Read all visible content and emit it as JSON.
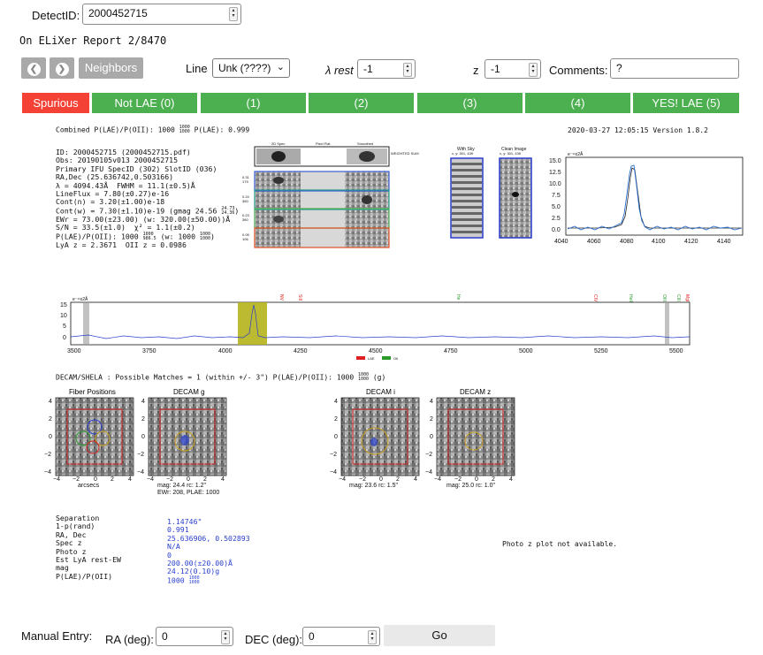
{
  "detect": {
    "label": "DetectID:",
    "value": "2000452715"
  },
  "report_title": "On ELiXer Report 2/8470",
  "nav": {
    "prev_icon": "chevron-left-icon",
    "next_icon": "chevron-right-icon",
    "neighbors_label": "Neighbors"
  },
  "line": {
    "label": "Line",
    "selected": "Unk (????)"
  },
  "lambda": {
    "label": "λ rest",
    "value": "-1"
  },
  "z": {
    "label": "z",
    "value": "-1"
  },
  "comments": {
    "label": "Comments:",
    "value": "?"
  },
  "classify": {
    "buttons": [
      "Spurious",
      "Not LAE (0)",
      "(1)",
      "(2)",
      "(3)",
      "(4)",
      "YES! LAE (5)"
    ],
    "colors": {
      "spurious": "#f44336",
      "other": "#4caf50"
    }
  },
  "report": {
    "combined": "Combined P(LAE)/P(OII): 1000",
    "combined_frac_top": "1000",
    "combined_frac_bot": "1000",
    "combined_tail": "P(LAE): 0.999",
    "date_version": "2020-03-27 12:05:15   Version 1.8.2",
    "stats": [
      "ID: 2000452715 (2000452715.pdf)",
      "Obs: 20190105v013 2000452715",
      "Primary IFU SpecID (302) SlotID (036)",
      "RA,Dec (25.636742,0.503166)",
      "λ = 4094.43Å  FWHM = 11.1(±0.5)Å",
      "LineFlux = 7.80(±0.27)e-16",
      "Cont(n) = 3.20(±1.00)e-18",
      "Cont(w) = 7.30(±1.10)e-19 (gmag 24.56",
      "EWr = 73.00(±23.00) (w: 320.00(±50.00))Å",
      "S/N = 33.5(±1.0)  χ² = 1.1(±0.2)",
      "P(LAE)/P(OII): 1000",
      "LyA z = 2.3671  OII z = 0.0986"
    ],
    "gmag_frac_top": "24.73",
    "gmag_frac_bot": "24.36",
    "plae_frac_top": "1000",
    "plae_frac_bot": "986.5",
    "plae_w": "(w: 1000",
    "plae_w_top": "1000",
    "plae_w_bot": "1000",
    "cutout_titles": {
      "spec2d": "2D Spec",
      "pixel_flat": "Pixel Flat",
      "smoothed": "Smoothed",
      "weighted": "WEIGHTED SUM"
    },
    "sky": {
      "title": "With Sky",
      "coords": "x, y: 301, 439"
    },
    "clean": {
      "title": "Clean Image",
      "coords": "x, y: 301, 439"
    },
    "fiber_weights": [
      "0.31",
      "0.24",
      "0.23",
      "0.05"
    ],
    "fiber_nums": [
      "179",
      "360",
      "360",
      "106"
    ]
  },
  "zoom_chart": {
    "ylabel": "e⁻¹¹x2Å",
    "xticks": [
      "4040",
      "4060",
      "4080",
      "4100",
      "4120",
      "4140"
    ],
    "yticks": [
      "15.0",
      "12.5",
      "10.0",
      "7.5",
      "5.0",
      "2.5",
      "0.0"
    ]
  },
  "full_chart": {
    "ylabel": "e⁻¹¹x2Å",
    "xticks": [
      "3500",
      "3750",
      "4000",
      "4250",
      "4500",
      "4750",
      "5000",
      "5250",
      "5500"
    ],
    "yticks": [
      "15",
      "10",
      "5",
      "0"
    ],
    "lines": [
      {
        "name": "NV",
        "color": "#e02020"
      },
      {
        "name": "SiII",
        "color": "#e02020"
      },
      {
        "name": "He",
        "color": "#2a9a2a"
      },
      {
        "name": "CIV",
        "color": "#e02020"
      },
      {
        "name": "HeII",
        "color": "#2a9a2a"
      },
      {
        "name": "OIII",
        "color": "#2a9a2a"
      },
      {
        "name": "CIII",
        "color": "#2a9a2a"
      },
      {
        "name": "MgII",
        "color": "#e02020"
      }
    ],
    "legend": [
      "LAE",
      "OII"
    ],
    "legend_colors": [
      "#e02020",
      "#2a9a2a"
    ]
  },
  "imaging": {
    "header": "DECAM/SHELA : Possible Matches = 1 (within +/- 3\")  P(LAE)/P(OII): 1000",
    "header_frac_top": "1000",
    "header_frac_bot": "1000",
    "header_tail": "(g)",
    "panels": [
      {
        "title": "Fiber Positions",
        "caption": "arcsecs",
        "caption2": ""
      },
      {
        "title": "DECAM g",
        "caption": "mag: 24.4  rc: 1.2\"",
        "caption2": "EWr: 208, PLAE: 1000"
      },
      {
        "title": "DECAM i",
        "caption": "mag: 23.6 rc: 1.5\"",
        "caption2": ""
      },
      {
        "title": "DECAM z",
        "caption": "mag: 25.0 rc: 1.0\"",
        "caption2": ""
      }
    ],
    "ticks": [
      "4",
      "2",
      "0",
      "−2",
      "−4"
    ],
    "xticks": [
      "−4",
      "−2",
      "0",
      "2",
      "4"
    ]
  },
  "match": {
    "labels": [
      "Separation",
      "1-p(rand)",
      "RA, Dec",
      "Spec z",
      "Photo z",
      "Est LyA rest-EW",
      "mag",
      "P(LAE)/P(OII)"
    ],
    "values": [
      "1.14746\"",
      "0.991",
      "25.636906, 0.502893",
      "N/A",
      "0",
      "200.00(±20.00)Å",
      "24.12(0.10)g",
      "1000"
    ],
    "plae_frac_top": "1000",
    "plae_frac_bot": "1000",
    "photoz_note": "Photo z plot not available."
  },
  "manual": {
    "label": "Manual Entry:",
    "ra_label": "RA (deg):",
    "ra_value": "0",
    "dec_label": "DEC (deg):",
    "dec_value": "0",
    "go_label": "Go"
  }
}
